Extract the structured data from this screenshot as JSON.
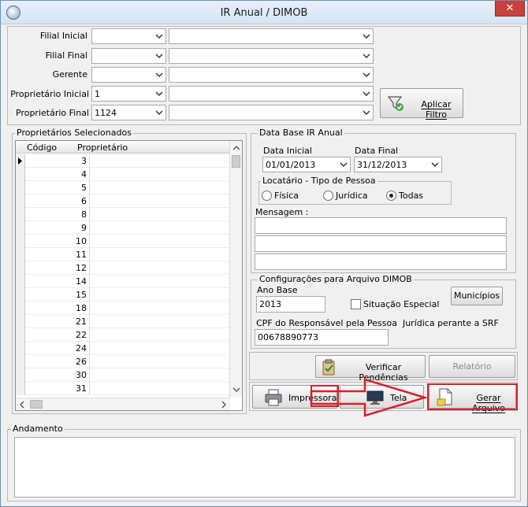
{
  "window": {
    "title": "IR Anual / DIMOB",
    "close_glyph": "✕"
  },
  "filters": {
    "filial_inicial_label": "Filial Inicial",
    "filial_final_label": "Filial Final",
    "gerente_label": "Gerente",
    "prop_inicial_label": "Proprietário Inicial",
    "prop_inicial_value": "1",
    "prop_final_label": "Proprietário Final",
    "prop_final_value": "1124",
    "apply_button": "Aplicar Filtro"
  },
  "grid": {
    "title": "Proprietários Selecionados",
    "col_codigo": "Código",
    "col_proprietario": "Proprietário",
    "rows": [
      "3",
      "4",
      "5",
      "6",
      "8",
      "9",
      "10",
      "11",
      "12",
      "14",
      "15",
      "18",
      "21",
      "22",
      "24",
      "26",
      "30",
      "31"
    ]
  },
  "ir_anual": {
    "title": "Data Base IR Anual",
    "data_inicial_label": "Data Inicial",
    "data_inicial_value": "01/01/2013",
    "data_final_label": "Data Final",
    "data_final_value": "31/12/2013",
    "locatario_label": "Locatário - Tipo de Pessoa",
    "opt_fisica": "Física",
    "opt_juridica": "Jurídica",
    "opt_todas": "Todas",
    "mensagem_label": "Mensagem :"
  },
  "dimob": {
    "title": "Configurações para Arquivo DIMOB",
    "ano_base_label": "Ano Base",
    "ano_base_value": "2013",
    "situacao_label": "Situação Especial",
    "municipios_button": "Municípios",
    "cpf_label": "CPF do Responsável pela Pessoa  Jurídica perante a SRF",
    "cpf_value": "00678890773"
  },
  "actions": {
    "verificar_button": "Verificar Pendências",
    "relatorio_button": "Relatório",
    "impressora_button": "Impressora",
    "tela_button": "Tela",
    "gerar_button": "Gerar Arquivo"
  },
  "andamento": {
    "title": "Andamento"
  },
  "colors": {
    "highlight_red": "#d8202a",
    "close_red": "#c9413a"
  }
}
